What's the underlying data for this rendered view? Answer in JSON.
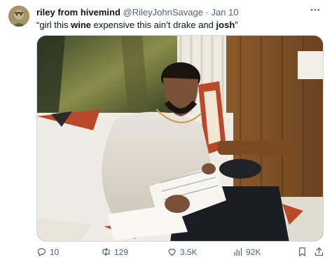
{
  "tweet": {
    "author_name": "riley from hivemind",
    "author_handle": "@RileyJohnSavage",
    "separator": "·",
    "date": "Jan 10",
    "text_parts": [
      "“girl this ",
      "wine",
      " expensive this ain’t drake and ",
      "josh",
      "”"
    ]
  },
  "media": {},
  "actions": {
    "reply_count": "10",
    "retweet_count": "129",
    "like_count": "3.5K",
    "view_count": "92K"
  },
  "icons": {
    "more": "more-icon",
    "reply": "reply-icon",
    "retweet": "retweet-icon",
    "like": "heart-icon",
    "views": "views-icon",
    "bookmark": "bookmark-icon",
    "share": "share-icon"
  },
  "colors": {
    "text": "#0f1419",
    "muted": "#536471",
    "border": "#cfd9de"
  }
}
